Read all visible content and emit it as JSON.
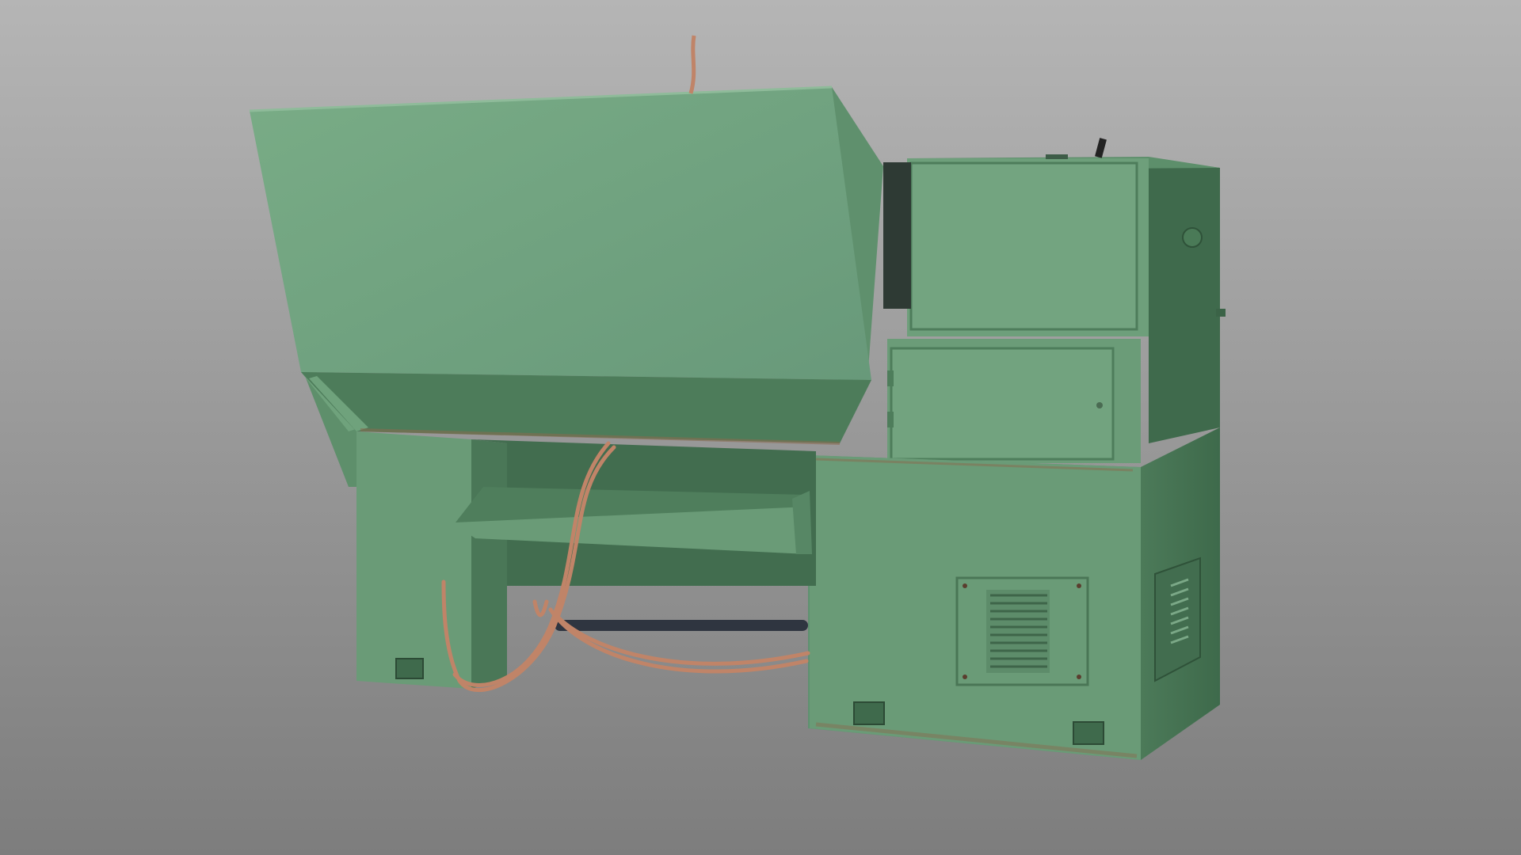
{
  "scene": {
    "subject": "machine-tool-3d-model",
    "colors": {
      "background_top": "#b5b5b5",
      "background_bottom": "#7d7d7d",
      "body_green": "#6fa27c",
      "body_green_light": "#78ab84",
      "body_green_shadow": "#4f7e5c",
      "body_green_dark": "#3f6a4c",
      "cable_copper": "#c08468",
      "rod_dark": "#2f3540",
      "rust": "#8a6a4f"
    }
  }
}
